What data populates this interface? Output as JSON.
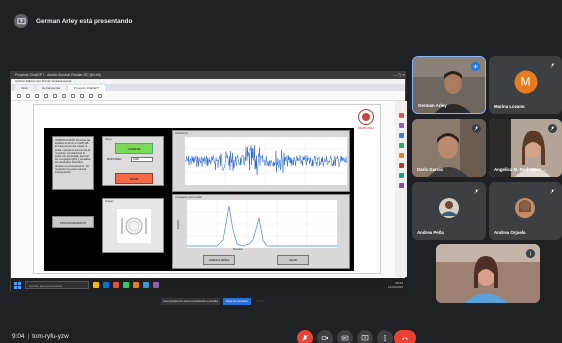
{
  "banner": {
    "text": "German Arley está presentando"
  },
  "screen": {
    "window_title": "Proyecto ChatGPT - Adobe Acrobat Reader DC (64-bit)",
    "menu_text": "Archivo  Edición  Ver  Firmar  Ventana  Ayuda",
    "tabs": [
      "Inicio",
      "Herramientas",
      "Proyecto ChatGPT"
    ],
    "seal_text": "PAMPLONA",
    "gui_text_block": "INTRODUCCIÓN Procesar las señales de ECG en MATLAB. El sistema permite cargar la señal, calcular la frecuencia de muestreo, correlacionar la señal con la plantilla, detectar los complejos QRS y visualizar los resultados obtenidos durante el procesamiento. Se muestran los pasos para la interpretación.",
    "proc_button": "PROCESAMIENTO",
    "ctrl_panel_label": "Panel",
    "green_button": "CARGAR",
    "fs_label": "MUESTREO",
    "fs_value": "1000",
    "red_button": "SALIR",
    "img_panel_label": "Imagen",
    "ecg_panel_label": "Señal ECG",
    "corr_panel_label": "Correlación de la señal",
    "corr_xlabel": "Muestras",
    "corr_ylabel": "Amplitud",
    "btn_correlation": "GRAFICA SEÑAL",
    "btn_exit": "SALIR",
    "share_msg": "meet.google.com está compartiendo tu pantalla.",
    "share_stop": "Dejar de compartir",
    "share_hide": "Ocultar",
    "watermark": "La coordinación de las señales",
    "task_search": "Escribe aquí para buscar",
    "tray_time": "09:04",
    "tray_date": "14/03/2023"
  },
  "participants": [
    {
      "name": "German Arley",
      "speaking": true
    },
    {
      "name": "Marina Lozano",
      "avatar_letter": "M",
      "avatar_color": "#e67c1f"
    },
    {
      "name": "Daris Garcia"
    },
    {
      "name": "Angelica M. Rodriguez ..."
    },
    {
      "name": "Andrea Peña"
    },
    {
      "name": "Andrea Orjuela"
    }
  ],
  "meeting": {
    "time": "9:04",
    "code": "tom-ryfu-yzw"
  },
  "controls": [
    "mic-off",
    "camera",
    "captions",
    "present",
    "more",
    "end-call"
  ]
}
